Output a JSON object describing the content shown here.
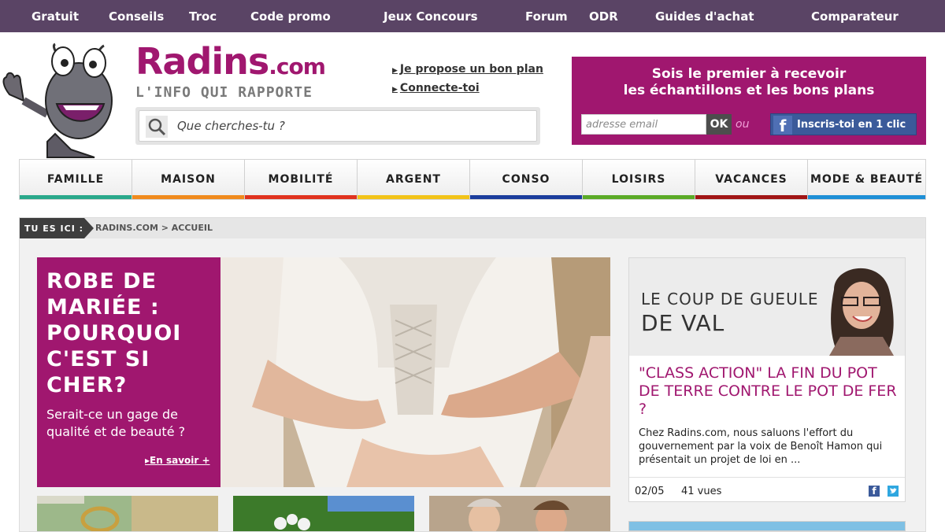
{
  "topnav": {
    "items": [
      "Gratuit",
      "Conseils",
      "Troc",
      "Code promo",
      "Jeux Concours",
      "Forum",
      "ODR",
      "Guides d'achat",
      "Comparateur"
    ]
  },
  "logo": {
    "brand": "Radins",
    "brand_suffix": ".com",
    "tagline": "L'INFO QUI RAPPORTE"
  },
  "quicklinks": [
    "Je propose un bon plan",
    "Connecte-toi"
  ],
  "search": {
    "placeholder": "Que cherches-tu ?"
  },
  "newsletter": {
    "title_line1": "Sois le premier à recevoir",
    "title_line2": "les échantillons et les bons plans",
    "email_placeholder": "adresse email",
    "ok_label": "OK",
    "or_label": "ou",
    "fb_label": "Inscris-toi en 1 clic"
  },
  "categories": [
    {
      "label": "FAMILLE",
      "color": "#2aa98b"
    },
    {
      "label": "MAISON",
      "color": "#f08a1c"
    },
    {
      "label": "MOBILITÉ",
      "color": "#e0321e"
    },
    {
      "label": "ARGENT",
      "color": "#f2c318"
    },
    {
      "label": "CONSO",
      "color": "#1b3d9c"
    },
    {
      "label": "LOISIRS",
      "color": "#5aaa26"
    },
    {
      "label": "VACANCES",
      "color": "#a01414"
    },
    {
      "label": "MODE & BEAUTÉ",
      "color": "#1e8fd6"
    }
  ],
  "breadcrumb": {
    "here_label": "TU ES ICI :",
    "path": "RADINS.COM > ACCUEIL"
  },
  "feature": {
    "headline": "ROBE DE MARIÉE : POURQUOI C'EST SI CHER?",
    "subtitle": "Serait-ce un gage de qualité et de beauté ?",
    "more_label": "En savoir +"
  },
  "val": {
    "header_line1": "LE COUP DE GUEULE",
    "header_line2": "DE VAL",
    "title": "\"CLASS ACTION\" LA FIN DU POT DE TERRE CONTRE LE POT DE FER ?",
    "excerpt": "Chez Radins.com, nous saluons l'effort du gouvernement par la voix de Benoît Hamon qui présentait un projet de loi en ...",
    "date": "02/05",
    "views": "41 vues"
  },
  "colors": {
    "brand": "#a0176f",
    "topnav_bg": "#5a4465",
    "facebook": "#3b5a9a",
    "twitter": "#2fa7e0"
  }
}
